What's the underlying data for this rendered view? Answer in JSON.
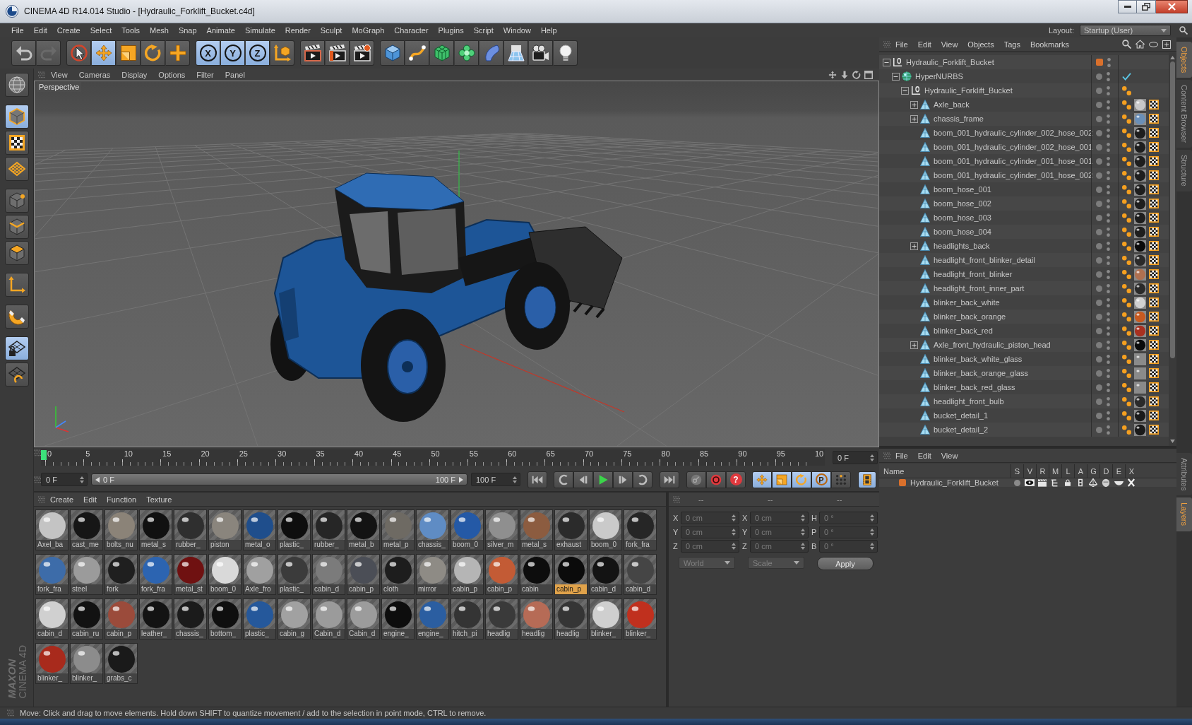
{
  "window": {
    "title": "CINEMA 4D R14.014 Studio - [Hydraulic_Forklift_Bucket.c4d]"
  },
  "menu_bar": {
    "items": [
      "File",
      "Edit",
      "Create",
      "Select",
      "Tools",
      "Mesh",
      "Snap",
      "Animate",
      "Simulate",
      "Render",
      "Sculpt",
      "MoGraph",
      "Character",
      "Plugins",
      "Script",
      "Window",
      "Help"
    ],
    "layout_label": "Layout:",
    "layout_value": "Startup (User)"
  },
  "toolbar": {
    "history": [
      {
        "disabled": false
      },
      {
        "disabled": true
      }
    ],
    "tools": [
      {
        "selected": false
      },
      {
        "selected": true
      },
      {
        "selected": false
      },
      {
        "selected": false
      },
      {
        "selected": false
      }
    ],
    "axis_locks": [
      {
        "label": "X",
        "selected": true
      },
      {
        "label": "Y",
        "selected": true
      },
      {
        "label": "Z",
        "selected": true
      }
    ]
  },
  "mode_palette": [
    {
      "selected": false
    },
    {
      "selected": true
    },
    {
      "selected": false
    },
    {
      "selected": false
    },
    {
      "selected": false
    },
    {
      "selected": false
    },
    {
      "selected": false
    },
    {
      "selected": false
    },
    {
      "selected": false
    },
    {
      "selected": true
    },
    {
      "selected": false
    }
  ],
  "logo": {
    "brand": "MAXON",
    "product": "CINEMA 4D"
  },
  "viewport": {
    "menu": [
      "View",
      "Cameras",
      "Display",
      "Options",
      "Filter",
      "Panel"
    ],
    "camera": "Perspective"
  },
  "timeline": {
    "labels": [
      "0",
      "5",
      "10",
      "15",
      "20",
      "25",
      "30",
      "35",
      "40",
      "45",
      "50",
      "55",
      "60",
      "65",
      "70",
      "75",
      "80",
      "85",
      "90",
      "95",
      "10"
    ],
    "level": 0,
    "current_frame": "0 F"
  },
  "playback": {
    "start": "0 F",
    "range": {
      "start": "0 F",
      "end": "100 F"
    },
    "end": "100 F",
    "record": [
      {
        "disabled": true
      },
      {
        "disabled": false
      },
      {
        "label": "?",
        "disabled": false
      }
    ],
    "key_filters": [
      {
        "selected": true
      },
      {
        "selected": true
      },
      {
        "selected": true
      },
      {
        "label": "P",
        "selected": true
      },
      {
        "selected": false
      }
    ],
    "timeline_toggle": {
      "selected": true
    }
  },
  "material_manager": {
    "menu": [
      "Create",
      "Edit",
      "Function",
      "Texture"
    ],
    "materials": [
      {
        "name": "Axel_ba",
        "color": "#c4c4c4",
        "selected": false
      },
      {
        "name": "cast_me",
        "color": "#161616",
        "selected": false
      },
      {
        "name": "bolts_nu",
        "color": "#8b8378",
        "selected": false
      },
      {
        "name": "metal_s",
        "color": "#111111",
        "selected": false
      },
      {
        "name": "rubber_",
        "color": "#2f2f2f",
        "selected": false
      },
      {
        "name": "piston",
        "color": "#8a857d",
        "selected": false
      },
      {
        "name": "metal_o",
        "color": "#1f4e8c",
        "selected": false
      },
      {
        "name": "plastic_",
        "color": "#0e0e0e",
        "selected": false
      },
      {
        "name": "rubber_",
        "color": "#262626",
        "selected": false
      },
      {
        "name": "metal_b",
        "color": "#131313",
        "selected": false
      },
      {
        "name": "metal_p",
        "color": "#6e6a63",
        "selected": false
      },
      {
        "name": "chassis_",
        "color": "#5f8cc4",
        "selected": false
      },
      {
        "name": "boom_0",
        "color": "#2459a6",
        "selected": false
      },
      {
        "name": "silver_m",
        "color": "#8f8f8f",
        "selected": false
      },
      {
        "name": "metal_s",
        "color": "#8c5c40",
        "selected": false
      },
      {
        "name": "exhaust",
        "color": "#2b2b2b",
        "selected": false
      },
      {
        "name": "boom_0",
        "color": "#cacaca",
        "selected": false
      },
      {
        "name": "fork_fra",
        "color": "#262626",
        "selected": false
      },
      {
        "name": "fork_fra",
        "color": "#3d6ca9",
        "selected": false
      },
      {
        "name": "steel",
        "color": "#9b9b9b",
        "selected": false
      },
      {
        "name": "fork",
        "color": "#1f1f1f",
        "selected": false
      },
      {
        "name": "fork_fra",
        "color": "#2c64b1",
        "selected": false
      },
      {
        "name": "metal_st",
        "color": "#6f1111",
        "selected": false
      },
      {
        "name": "boom_0",
        "color": "#d9d9d9",
        "selected": false
      },
      {
        "name": "Axle_fro",
        "color": "#a0a0a0",
        "selected": false
      },
      {
        "name": "plastic_",
        "color": "#3b3b3b",
        "selected": false
      },
      {
        "name": "cabin_d",
        "color": "#7b7b7b",
        "selected": false
      },
      {
        "name": "cabin_p",
        "color": "#4b4e56",
        "selected": false
      },
      {
        "name": "cloth",
        "color": "#1d1d1d",
        "selected": false
      },
      {
        "name": "mirror",
        "color": "#8e8b85",
        "selected": false
      },
      {
        "name": "cabin_p",
        "color": "#b5b5b5",
        "selected": false
      },
      {
        "name": "cabin_p",
        "color": "#c35b35",
        "selected": false
      },
      {
        "name": "cabin",
        "color": "#0d0d0d",
        "selected": false
      },
      {
        "name": "cabin_p",
        "color": "#0b0b0b",
        "selected": true
      },
      {
        "name": "cabin_d",
        "color": "#131313",
        "selected": false
      },
      {
        "name": "cabin_d",
        "color": "#454545",
        "selected": false
      },
      {
        "name": "cabin_d",
        "color": "#d0d0d0",
        "selected": false
      },
      {
        "name": "cabin_ru",
        "color": "#121212",
        "selected": false
      },
      {
        "name": "cabin_p",
        "color": "#9b4b3b",
        "selected": false
      },
      {
        "name": "leather_",
        "color": "#131313",
        "selected": false
      },
      {
        "name": "chassis_",
        "color": "#1b1b1b",
        "selected": false
      },
      {
        "name": "bottom_",
        "color": "#0f0f0f",
        "selected": false
      },
      {
        "name": "plastic_",
        "color": "#25589b",
        "selected": false
      },
      {
        "name": "cabin_g",
        "color": "#a1a1a1",
        "selected": false
      },
      {
        "name": "Cabin_d",
        "color": "#9b9b9b",
        "selected": false
      },
      {
        "name": "Cabin_d",
        "color": "#9c9c9c",
        "selected": false
      },
      {
        "name": "engine_",
        "color": "#0d0d0d",
        "selected": false
      },
      {
        "name": "engine_",
        "color": "#2b5ea1",
        "selected": false
      },
      {
        "name": "hitch_pi",
        "color": "#343434",
        "selected": false
      },
      {
        "name": "headlig",
        "color": "#3a3a3a",
        "selected": false
      },
      {
        "name": "headlig",
        "color": "#b66b56",
        "selected": false
      },
      {
        "name": "headlig",
        "color": "#353535",
        "selected": false
      },
      {
        "name": "blinker_",
        "color": "#cfcfcf",
        "selected": false
      },
      {
        "name": "blinker_",
        "color": "#c0301e",
        "selected": false
      },
      {
        "name": "blinker_",
        "color": "#a82a1c",
        "selected": false
      },
      {
        "name": "blinker_",
        "color": "#8c8c8c",
        "selected": false
      },
      {
        "name": "grabs_c",
        "color": "#1a1a1a",
        "selected": false
      }
    ]
  },
  "coordinates": {
    "disabled": true,
    "columns": [
      {
        "header": "--",
        "fields": [
          {
            "label": "X",
            "value": "0 cm"
          },
          {
            "label": "Y",
            "value": "0 cm"
          },
          {
            "label": "Z",
            "value": "0 cm"
          }
        ]
      },
      {
        "header": "--",
        "fields": [
          {
            "label": "X",
            "value": "0 cm"
          },
          {
            "label": "Y",
            "value": "0 cm"
          },
          {
            "label": "Z",
            "value": "0 cm"
          }
        ]
      },
      {
        "header": "--",
        "fields": [
          {
            "label": "H",
            "value": "0 °"
          },
          {
            "label": "P",
            "value": "0 °"
          },
          {
            "label": "B",
            "value": "0 °"
          }
        ]
      }
    ],
    "dropdowns": [
      "World",
      "Scale"
    ],
    "apply": "Apply"
  },
  "object_manager": {
    "menu": [
      "File",
      "Edit",
      "View",
      "Objects",
      "Tags",
      "Bookmarks"
    ],
    "objects": [
      {
        "name": "Hydraulic_Forklift_Bucket",
        "kind": "null",
        "expanded": true,
        "color": "#d9702c",
        "children": [
          {
            "name": "HyperNURBS",
            "kind": "generator",
            "expanded": true,
            "enabled": true,
            "children": [
              {
                "name": "Hydraulic_Forklift_Bucket",
                "kind": "null",
                "expanded": true,
                "tags": [
                  {
                    "kind": "phong"
                  }
                ],
                "children": [
                  {
                    "name": "Axle_back",
                    "kind": "polygon",
                    "expanded": false,
                    "tags": [
                      {
                        "kind": "phong"
                      },
                      {
                        "kind": "material",
                        "color": "#c8c8c8"
                      },
                      {
                        "kind": "uvw"
                      }
                    ]
                  },
                  {
                    "name": "chassis_frame",
                    "kind": "polygon",
                    "expanded": false,
                    "tags": [
                      {
                        "kind": "phong"
                      },
                      {
                        "kind": "material",
                        "color": "#6a8fb8"
                      },
                      {
                        "kind": "uvw"
                      }
                    ]
                  },
                  {
                    "name": "boom_001_hydraulic_cylinder_002_hose_002",
                    "kind": "polygon",
                    "tags": [
                      {
                        "kind": "phong"
                      },
                      {
                        "kind": "material",
                        "color": "#1e1e1e"
                      },
                      {
                        "kind": "uvw"
                      }
                    ]
                  },
                  {
                    "name": "boom_001_hydraulic_cylinder_002_hose_001",
                    "kind": "polygon",
                    "tags": [
                      {
                        "kind": "phong"
                      },
                      {
                        "kind": "material",
                        "color": "#1e1e1e"
                      },
                      {
                        "kind": "uvw"
                      }
                    ]
                  },
                  {
                    "name": "boom_001_hydraulic_cylinder_001_hose_001",
                    "kind": "polygon",
                    "tags": [
                      {
                        "kind": "phong"
                      },
                      {
                        "kind": "material",
                        "color": "#1e1e1e"
                      },
                      {
                        "kind": "uvw"
                      }
                    ]
                  },
                  {
                    "name": "boom_001_hydraulic_cylinder_001_hose_002",
                    "kind": "polygon",
                    "tags": [
                      {
                        "kind": "phong"
                      },
                      {
                        "kind": "material",
                        "color": "#1e1e1e"
                      },
                      {
                        "kind": "uvw"
                      }
                    ]
                  },
                  {
                    "name": "boom_hose_001",
                    "kind": "polygon",
                    "tags": [
                      {
                        "kind": "phong"
                      },
                      {
                        "kind": "material",
                        "color": "#1e1e1e"
                      },
                      {
                        "kind": "uvw"
                      }
                    ]
                  },
                  {
                    "name": "boom_hose_002",
                    "kind": "polygon",
                    "tags": [
                      {
                        "kind": "phong"
                      },
                      {
                        "kind": "material",
                        "color": "#1e1e1e"
                      },
                      {
                        "kind": "uvw"
                      }
                    ]
                  },
                  {
                    "name": "boom_hose_003",
                    "kind": "polygon",
                    "tags": [
                      {
                        "kind": "phong"
                      },
                      {
                        "kind": "material",
                        "color": "#1e1e1e"
                      },
                      {
                        "kind": "uvw"
                      }
                    ]
                  },
                  {
                    "name": "boom_hose_004",
                    "kind": "polygon",
                    "tags": [
                      {
                        "kind": "phong"
                      },
                      {
                        "kind": "material",
                        "color": "#1e1e1e"
                      },
                      {
                        "kind": "uvw"
                      }
                    ]
                  },
                  {
                    "name": "headlights_back",
                    "kind": "polygon",
                    "expanded": false,
                    "tags": [
                      {
                        "kind": "phong"
                      },
                      {
                        "kind": "material",
                        "color": "#0a0a0a"
                      },
                      {
                        "kind": "uvw"
                      }
                    ]
                  },
                  {
                    "name": "headlight_front_blinker_detail",
                    "kind": "polygon",
                    "tags": [
                      {
                        "kind": "phong"
                      },
                      {
                        "kind": "material",
                        "color": "#2a2a2a"
                      },
                      {
                        "kind": "uvw"
                      }
                    ]
                  },
                  {
                    "name": "headlight_front_blinker",
                    "kind": "polygon",
                    "tags": [
                      {
                        "kind": "phong"
                      },
                      {
                        "kind": "material",
                        "color": "#b07050"
                      },
                      {
                        "kind": "uvw"
                      }
                    ]
                  },
                  {
                    "name": "headlight_front_inner_part",
                    "kind": "polygon",
                    "tags": [
                      {
                        "kind": "phong"
                      },
                      {
                        "kind": "material",
                        "color": "#2a2a2a"
                      },
                      {
                        "kind": "uvw"
                      }
                    ]
                  },
                  {
                    "name": "blinker_back_white",
                    "kind": "polygon",
                    "tags": [
                      {
                        "kind": "phong"
                      },
                      {
                        "kind": "material",
                        "color": "#d0d0d0"
                      },
                      {
                        "kind": "uvw"
                      }
                    ]
                  },
                  {
                    "name": "blinker_back_orange",
                    "kind": "polygon",
                    "tags": [
                      {
                        "kind": "phong"
                      },
                      {
                        "kind": "material",
                        "color": "#c85a20"
                      },
                      {
                        "kind": "uvw"
                      }
                    ]
                  },
                  {
                    "name": "blinker_back_red",
                    "kind": "polygon",
                    "tags": [
                      {
                        "kind": "phong"
                      },
                      {
                        "kind": "material",
                        "color": "#a83020"
                      },
                      {
                        "kind": "uvw"
                      }
                    ]
                  },
                  {
                    "name": "Axle_front_hydraulic_piston_head",
                    "kind": "polygon",
                    "expanded": false,
                    "tags": [
                      {
                        "kind": "phong"
                      },
                      {
                        "kind": "material",
                        "color": "#0a0a0a"
                      },
                      {
                        "kind": "uvw"
                      }
                    ]
                  },
                  {
                    "name": "blinker_back_white_glass",
                    "kind": "polygon",
                    "tags": [
                      {
                        "kind": "phong"
                      },
                      {
                        "kind": "material",
                        "color": "#8a8a8a"
                      },
                      {
                        "kind": "uvw"
                      }
                    ]
                  },
                  {
                    "name": "blinker_back_orange_glass",
                    "kind": "polygon",
                    "tags": [
                      {
                        "kind": "phong"
                      },
                      {
                        "kind": "material",
                        "color": "#8a8a8a"
                      },
                      {
                        "kind": "uvw"
                      }
                    ]
                  },
                  {
                    "name": "blinker_back_red_glass",
                    "kind": "polygon",
                    "tags": [
                      {
                        "kind": "phong"
                      },
                      {
                        "kind": "material",
                        "color": "#8a8a8a"
                      },
                      {
                        "kind": "uvw"
                      }
                    ]
                  },
                  {
                    "name": "headlight_front_bulb",
                    "kind": "polygon",
                    "tags": [
                      {
                        "kind": "phong"
                      },
                      {
                        "kind": "material",
                        "color": "#2a2a2a"
                      },
                      {
                        "kind": "uvw"
                      }
                    ]
                  },
                  {
                    "name": "bucket_detail_1",
                    "kind": "polygon",
                    "tags": [
                      {
                        "kind": "phong"
                      },
                      {
                        "kind": "material",
                        "color": "#1a1a1a"
                      },
                      {
                        "kind": "uvw"
                      }
                    ]
                  },
                  {
                    "name": "bucket_detail_2",
                    "kind": "polygon",
                    "tags": [
                      {
                        "kind": "phong"
                      },
                      {
                        "kind": "material",
                        "color": "#1a1a1a"
                      },
                      {
                        "kind": "uvw"
                      }
                    ]
                  }
                ]
              }
            ]
          }
        ]
      }
    ]
  },
  "layer_manager": {
    "menu": [
      "File",
      "Edit",
      "View"
    ],
    "columns": [
      "Name",
      "S",
      "V",
      "R",
      "M",
      "L",
      "A",
      "G",
      "D",
      "E",
      "X"
    ],
    "layers": [
      {
        "name": "Hydraulic_Forklift_Bucket",
        "color": "#d9702c"
      }
    ]
  },
  "side_tabs": {
    "top": [
      {
        "label": "Objects",
        "selected": true
      },
      {
        "label": "Content Browser",
        "selected": false
      },
      {
        "label": "Structure",
        "selected": false
      }
    ],
    "bottom": [
      {
        "label": "Attributes",
        "selected": false
      },
      {
        "label": "Layers",
        "selected": true
      }
    ]
  },
  "status_bar": {
    "text": "Move: Click and drag to move elements. Hold down SHIFT to quantize movement / add to the selection in point mode, CTRL to remove."
  }
}
